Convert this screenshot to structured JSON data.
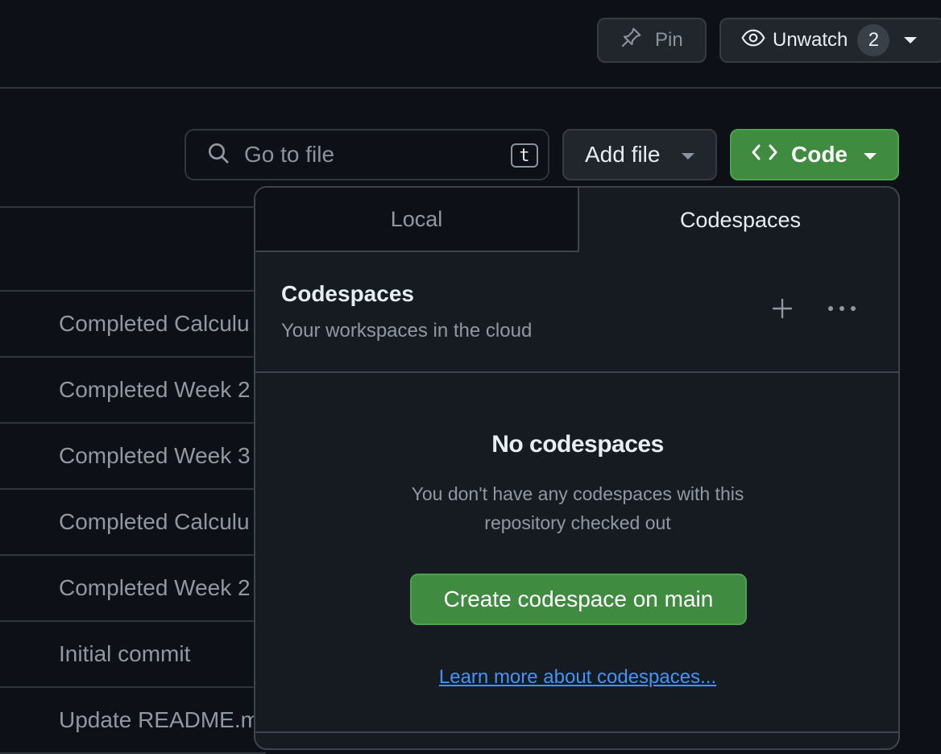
{
  "topbar": {
    "pin_label": "Pin",
    "unwatch_label": "Unwatch",
    "watch_count": "2"
  },
  "toolbar": {
    "search_placeholder": "Go to file",
    "search_shortcut": "t",
    "add_file_label": "Add file",
    "code_label": "Code"
  },
  "files": {
    "commits": [
      "Completed Calculu",
      "Completed Week 2",
      "Completed Week 3",
      "Completed Calculu",
      "Completed Week 2",
      "Initial commit",
      "Update README.m"
    ]
  },
  "code_dropdown": {
    "tabs": [
      "Local",
      "Codespaces"
    ],
    "active_tab": "Codespaces",
    "header_title": "Codespaces",
    "header_subtitle": "Your workspaces in the cloud",
    "empty_title": "No codespaces",
    "empty_description": "You don't have any codespaces with this repository checked out",
    "create_button": "Create codespace on main",
    "learn_more": "Learn more about codespaces..."
  },
  "colors": {
    "background": "#0d1117",
    "panel": "#161b22",
    "primary_green": "#3f8c40",
    "link_blue": "#4493f8",
    "border": "#30363d"
  },
  "icons": [
    "pin-icon",
    "eye-icon",
    "search-icon",
    "code-icon",
    "plus-icon",
    "kebab-icon",
    "caret-down-icon"
  ]
}
